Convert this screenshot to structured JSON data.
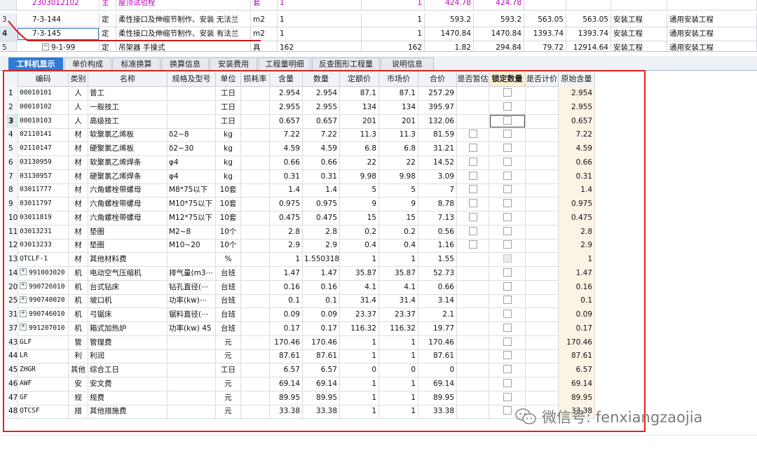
{
  "top_grid": {
    "rows": [
      {
        "idx": "",
        "code": "2303012102",
        "type": "主",
        "name": "屋顶试验栓",
        "unit": "套",
        "qty": "1",
        "qty2": "1",
        "price": "424.78",
        "total": "424.78",
        "mprice": "",
        "mtotal": "",
        "category": "",
        "profession": "",
        "pink": true
      },
      {
        "idx": "3",
        "code": "7-3-144",
        "type": "定",
        "name": "柔性接口及伸缩节制作、安装 无法兰",
        "unit": "m2",
        "qty": "1",
        "qty2": "1",
        "price": "593.2",
        "total": "593.2",
        "mprice": "563.05",
        "mtotal": "563.05",
        "category": "安装工程",
        "profession": "通用安装工程"
      },
      {
        "idx": "4",
        "code": "7-3-145",
        "type": "定",
        "name": "柔性接口及伸缩节制作、安装 有法兰",
        "unit": "m2",
        "qty": "1",
        "qty2": "1",
        "price": "1470.84",
        "total": "1470.84",
        "mprice": "1393.74",
        "mtotal": "1393.74",
        "category": "安装工程",
        "profession": "通用安装工程",
        "selected": true
      },
      {
        "idx": "5",
        "code": "9-1-99",
        "type": "定",
        "name": "吊架器 手操式",
        "unit": "具",
        "qty": "162",
        "qty2": "162",
        "price": "1.82",
        "total": "294.84",
        "mprice": "79.72",
        "mtotal": "12914.64",
        "category": "安装工程",
        "profession": "通用安装工程",
        "collapse": true
      }
    ]
  },
  "tabs": [
    "工料机显示",
    "单价构成",
    "标准换算",
    "换算信息",
    "安装费用",
    "工程量明细",
    "反查图形工程量",
    "说明信息"
  ],
  "active_tab": 0,
  "columns": [
    "编码",
    "类别",
    "名称",
    "规格及型号",
    "单位",
    "损耗率",
    "含量",
    "数量",
    "定额价",
    "市场价",
    "合价",
    "是否暂估",
    "锁定数量",
    "是否计价",
    "原始含量"
  ],
  "rows": [
    {
      "idx": "1",
      "code": "00010101",
      "type": "人",
      "name": "普工",
      "spec": "",
      "unit": "工日",
      "loss": "",
      "content": "2.954",
      "qty": "2.954",
      "quota": "87.1",
      "market": "87.1",
      "total": "257.29",
      "est": "none",
      "lock": "cb",
      "orig": "2.954"
    },
    {
      "idx": "2",
      "code": "00010102",
      "type": "人",
      "name": "一般技工",
      "spec": "",
      "unit": "工日",
      "loss": "",
      "content": "2.955",
      "qty": "2.955",
      "quota": "134",
      "market": "134",
      "total": "395.97",
      "est": "none",
      "lock": "cb",
      "orig": "2.955"
    },
    {
      "idx": "3",
      "code": "00010103",
      "type": "人",
      "name": "高级技工",
      "spec": "",
      "unit": "工日",
      "loss": "",
      "content": "0.657",
      "qty": "0.657",
      "quota": "201",
      "market": "201",
      "total": "132.06",
      "est": "none",
      "lock": "cb",
      "orig": "0.657",
      "selected": true
    },
    {
      "idx": "4",
      "code": "02110141",
      "type": "材",
      "name": "软聚氯乙烯板",
      "spec": "δ2~8",
      "unit": "kg",
      "loss": "",
      "content": "7.22",
      "qty": "7.22",
      "quota": "11.3",
      "market": "11.3",
      "total": "81.59",
      "est": "cb",
      "lock": "cb",
      "orig": "7.22"
    },
    {
      "idx": "5",
      "code": "02110147",
      "type": "材",
      "name": "硬聚氯乙烯板",
      "spec": "δ2~30",
      "unit": "kg",
      "loss": "",
      "content": "4.59",
      "qty": "4.59",
      "quota": "6.8",
      "market": "6.8",
      "total": "31.21",
      "est": "cb",
      "lock": "cb",
      "orig": "4.59"
    },
    {
      "idx": "6",
      "code": "03130959",
      "type": "材",
      "name": "软聚氯乙烯焊条",
      "spec": "φ4",
      "unit": "kg",
      "loss": "",
      "content": "0.66",
      "qty": "0.66",
      "quota": "22",
      "market": "22",
      "total": "14.52",
      "est": "cb",
      "lock": "cb",
      "orig": "0.66"
    },
    {
      "idx": "7",
      "code": "03130957",
      "type": "材",
      "name": "硬聚氯乙烯焊条",
      "spec": "φ4",
      "unit": "kg",
      "loss": "",
      "content": "0.31",
      "qty": "0.31",
      "quota": "9.98",
      "market": "9.98",
      "total": "3.09",
      "est": "cb",
      "lock": "cb",
      "orig": "0.31"
    },
    {
      "idx": "8",
      "code": "03011777",
      "type": "材",
      "name": "六角螺栓带螺母",
      "spec": "M8*75以下",
      "unit": "10套",
      "loss": "",
      "content": "1.4",
      "qty": "1.4",
      "quota": "5",
      "market": "5",
      "total": "7",
      "est": "cb",
      "lock": "cb",
      "orig": "1.4"
    },
    {
      "idx": "9",
      "code": "03011797",
      "type": "材",
      "name": "六角螺栓带螺母",
      "spec": "M10*75以下",
      "unit": "10套",
      "loss": "",
      "content": "0.975",
      "qty": "0.975",
      "quota": "9",
      "market": "9",
      "total": "8.78",
      "est": "cb",
      "lock": "cb",
      "orig": "0.975"
    },
    {
      "idx": "10",
      "code": "03011819",
      "type": "材",
      "name": "六角螺栓带螺母",
      "spec": "M12*75以下",
      "unit": "10套",
      "loss": "",
      "content": "0.475",
      "qty": "0.475",
      "quota": "15",
      "market": "15",
      "total": "7.13",
      "est": "cb",
      "lock": "cb",
      "orig": "0.475"
    },
    {
      "idx": "11",
      "code": "03013231",
      "type": "材",
      "name": "垫圈",
      "spec": "M2~8",
      "unit": "10个",
      "loss": "",
      "content": "2.8",
      "qty": "2.8",
      "quota": "0.2",
      "market": "0.2",
      "total": "0.56",
      "est": "cb",
      "lock": "cb",
      "orig": "2.8"
    },
    {
      "idx": "12",
      "code": "03013233",
      "type": "材",
      "name": "垫圈",
      "spec": "M10~20",
      "unit": "10个",
      "loss": "",
      "content": "2.9",
      "qty": "2.9",
      "quota": "0.4",
      "market": "0.4",
      "total": "1.16",
      "est": "cb",
      "lock": "cb",
      "orig": "2.9"
    },
    {
      "idx": "13",
      "code": "QTCLF-1",
      "type": "材",
      "name": "其他材料费",
      "spec": "",
      "unit": "%",
      "loss": "",
      "content": "1",
      "qty": "1.550318",
      "quota": "1",
      "market": "1",
      "total": "1.55",
      "est": "none",
      "lock": "dis",
      "orig": "1"
    },
    {
      "idx": "14",
      "code": "991003020",
      "type": "机",
      "name": "电动空气压缩机",
      "spec": "排气量(m3⋯",
      "unit": "台班",
      "loss": "",
      "content": "1.47",
      "qty": "1.47",
      "quota": "35.87",
      "market": "35.87",
      "total": "52.73",
      "est": "none",
      "lock": "cb",
      "orig": "1.47",
      "plus": true
    },
    {
      "idx": "20",
      "code": "990726010",
      "type": "机",
      "name": "台式钻床",
      "spec": "钻孔直径(⋯",
      "unit": "台班",
      "loss": "",
      "content": "0.16",
      "qty": "0.16",
      "quota": "4.1",
      "market": "4.1",
      "total": "0.66",
      "est": "none",
      "lock": "cb",
      "orig": "0.16",
      "plus": true
    },
    {
      "idx": "25",
      "code": "990740020",
      "type": "机",
      "name": "坡口机",
      "spec": "功率(kw)⋯",
      "unit": "台班",
      "loss": "",
      "content": "0.1",
      "qty": "0.1",
      "quota": "31.4",
      "market": "31.4",
      "total": "3.14",
      "est": "none",
      "lock": "cb",
      "orig": "0.1",
      "plus": true
    },
    {
      "idx": "31",
      "code": "990746010",
      "type": "机",
      "name": "弓锯床",
      "spec": "锯料直径(⋯",
      "unit": "台班",
      "loss": "",
      "content": "0.09",
      "qty": "0.09",
      "quota": "23.37",
      "market": "23.37",
      "total": "2.1",
      "est": "none",
      "lock": "cb",
      "orig": "0.09",
      "plus": true
    },
    {
      "idx": "37",
      "code": "991207010",
      "type": "机",
      "name": "箱式加热炉",
      "spec": "功率(kw) 45",
      "unit": "台班",
      "loss": "",
      "content": "0.17",
      "qty": "0.17",
      "quota": "116.32",
      "market": "116.32",
      "total": "19.77",
      "est": "none",
      "lock": "cb",
      "orig": "0.17",
      "plus": true
    },
    {
      "idx": "43",
      "code": "GLF",
      "type": "管",
      "name": "管理费",
      "spec": "",
      "unit": "元",
      "loss": "",
      "content": "170.46",
      "qty": "170.46",
      "quota": "1",
      "market": "1",
      "total": "170.46",
      "est": "none",
      "lock": "cb",
      "orig": "170.46"
    },
    {
      "idx": "44",
      "code": "LR",
      "type": "利",
      "name": "利润",
      "spec": "",
      "unit": "元",
      "loss": "",
      "content": "87.61",
      "qty": "87.61",
      "quota": "1",
      "market": "1",
      "total": "87.61",
      "est": "none",
      "lock": "cb",
      "orig": "87.61"
    },
    {
      "idx": "45",
      "code": "ZHGR",
      "type": "其他",
      "name": "综合工日",
      "spec": "",
      "unit": "工日",
      "loss": "",
      "content": "6.57",
      "qty": "6.57",
      "quota": "0",
      "market": "0",
      "total": "0",
      "est": "none",
      "lock": "cb",
      "orig": "6.57"
    },
    {
      "idx": "46",
      "code": "AWF",
      "type": "安",
      "name": "安文费",
      "spec": "",
      "unit": "元",
      "loss": "",
      "content": "69.14",
      "qty": "69.14",
      "quota": "1",
      "market": "1",
      "total": "69.14",
      "est": "none",
      "lock": "cb",
      "orig": "69.14"
    },
    {
      "idx": "47",
      "code": "GF",
      "type": "规",
      "name": "规费",
      "spec": "",
      "unit": "元",
      "loss": "",
      "content": "89.95",
      "qty": "89.95",
      "quota": "1",
      "market": "1",
      "total": "89.95",
      "est": "none",
      "lock": "cb",
      "orig": "89.95"
    },
    {
      "idx": "48",
      "code": "QTCSF",
      "type": "措",
      "name": "其他措施费",
      "spec": "",
      "unit": "元",
      "loss": "",
      "content": "33.38",
      "qty": "33.38",
      "quota": "1",
      "market": "1",
      "total": "33.38",
      "est": "none",
      "lock": "cb",
      "orig": "33.38"
    }
  ],
  "watermark": "微信号: fenxiangzaojia",
  "colors": {
    "accent": "#2f7ad6",
    "highlight_border": "#e02020",
    "pink_text": "#c000c0",
    "lock_header": "#fbeed1"
  }
}
